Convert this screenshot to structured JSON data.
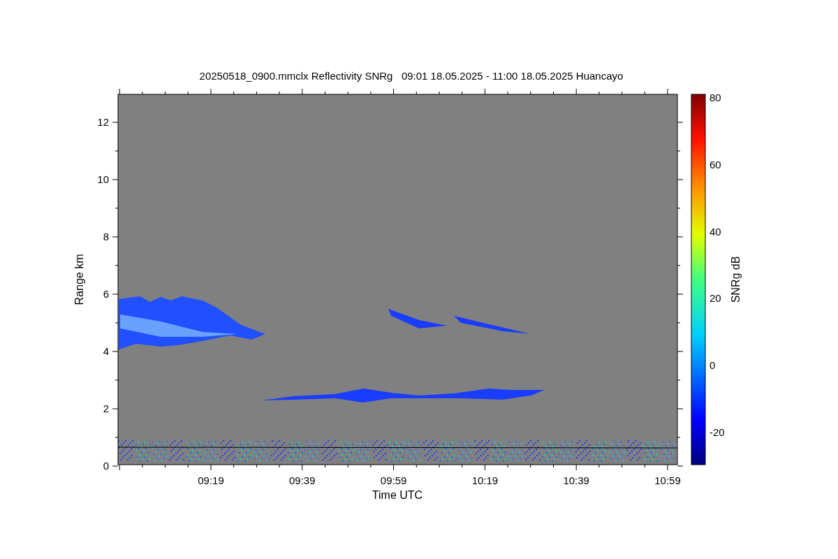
{
  "title": "20250518_0900.mmclx Reflectivity SNRg   09:01 18.05.2025 - 11:00 18.05.2025 Huancayo",
  "y_axis": {
    "label": "Range km",
    "ticks": [
      "12",
      "10",
      "8",
      "6",
      "4",
      "2",
      "0"
    ]
  },
  "x_axis": {
    "label": "Time UTC",
    "ticks": [
      "09:19",
      "09:39",
      "09:59",
      "10:19",
      "10:39",
      "10:59"
    ]
  },
  "colorbar": {
    "label": "SNRg dB",
    "ticks": [
      "80",
      "60",
      "40",
      "20",
      "0",
      "-20"
    ]
  }
}
